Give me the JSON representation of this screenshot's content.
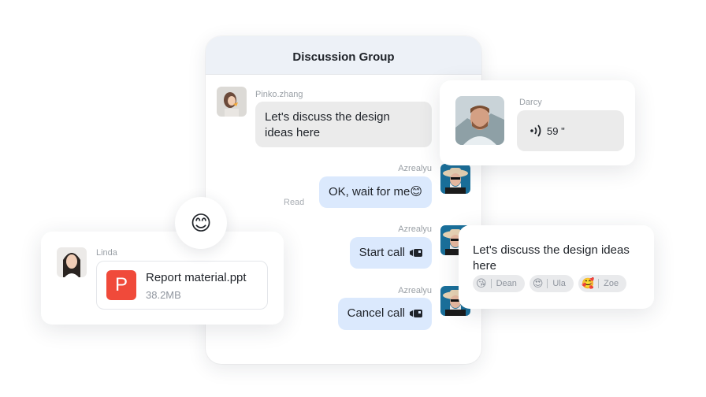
{
  "group": {
    "title": "Discussion Group"
  },
  "messages": [
    {
      "sender": "Pinko.zhang",
      "text": "Let's discuss the design ideas here",
      "line1": "Let's discuss the design",
      "line2": "ideas here",
      "side": "left"
    },
    {
      "sender": "Azrealyu",
      "text": "OK, wait for me",
      "emoji": "😊",
      "status": "Read",
      "side": "right"
    },
    {
      "sender": "Azrealyu",
      "text": "Start call",
      "icon": "video-call-icon",
      "side": "right"
    },
    {
      "sender": "Azrealyu",
      "text": "Cancel call",
      "icon": "video-call-icon",
      "side": "right"
    }
  ],
  "voice_card": {
    "sender": "Darcy",
    "duration": "59 \""
  },
  "file_card": {
    "sender": "Linda",
    "file_name": "Report material.ppt",
    "file_size": "38.2MB",
    "file_type_letter": "P"
  },
  "floating_emoji": "😊",
  "reaction_card": {
    "line1": "Let's discuss the design ideas",
    "line2": "here",
    "reactions": [
      {
        "emoji": "😘",
        "name": "Dean"
      },
      {
        "emoji": "😍",
        "name": "Ula"
      },
      {
        "emoji": "🥰",
        "name": "Zoe"
      }
    ]
  },
  "colors": {
    "header_bg": "#edf1f7",
    "own_bubble": "#dbe9fd",
    "other_bubble": "#ebebeb",
    "file_icon": "#f04a3a"
  }
}
